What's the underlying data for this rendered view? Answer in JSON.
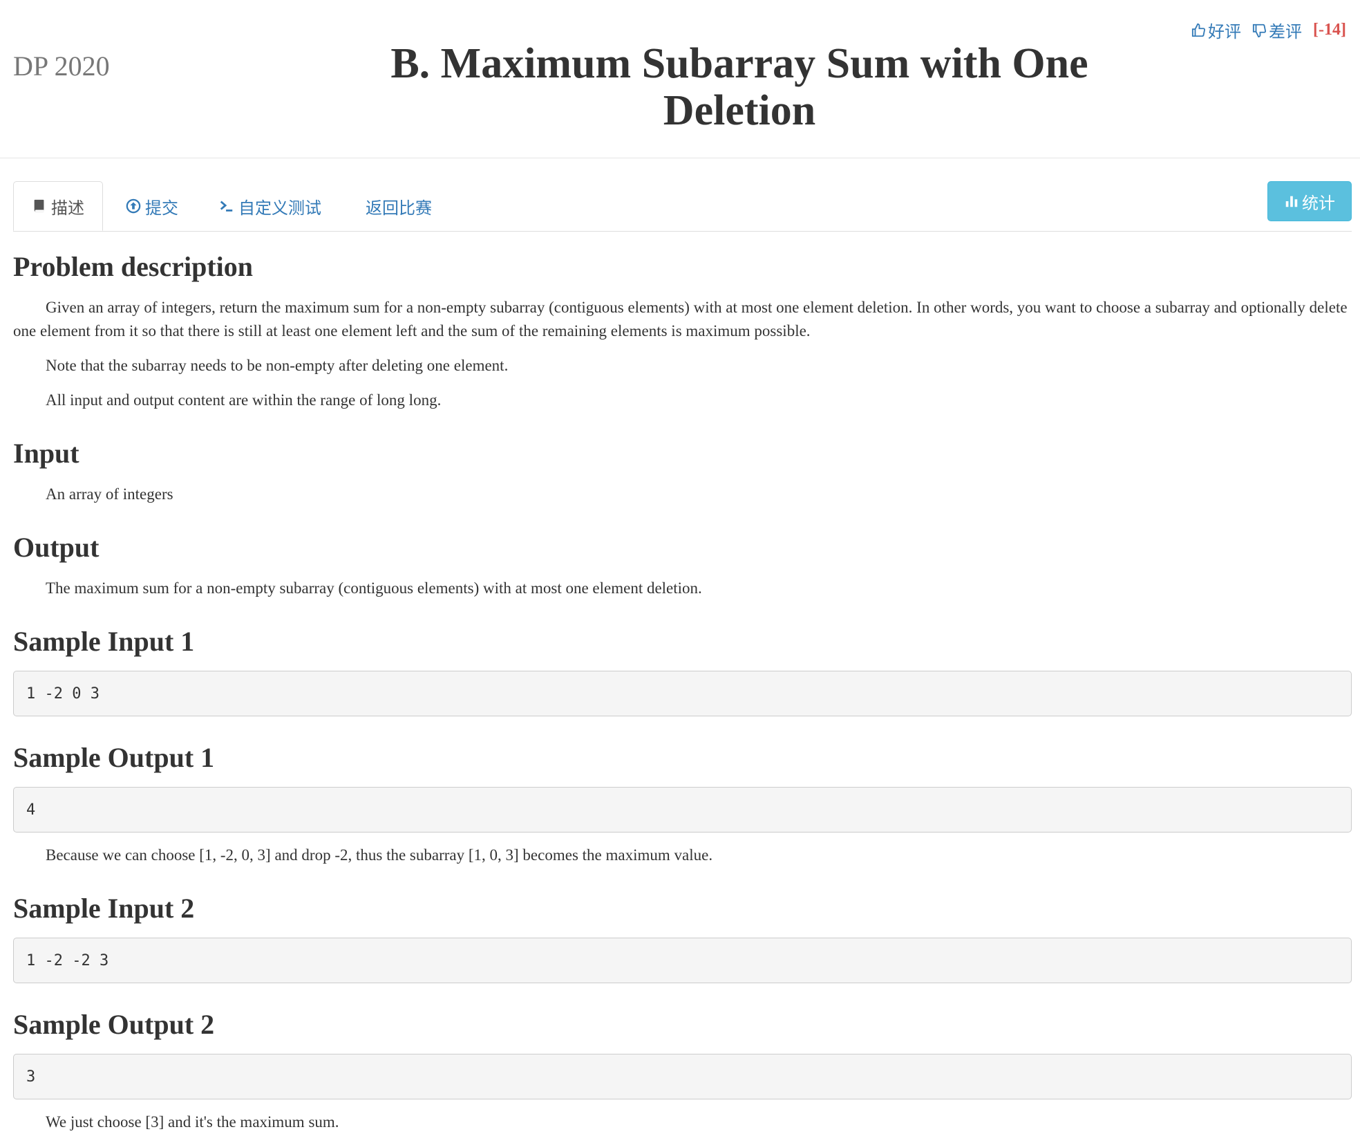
{
  "header": {
    "contest": "DP 2020",
    "title": "B. Maximum Subarray Sum with One Deletion",
    "rating": {
      "like_label": "好评",
      "dislike_label": "差评",
      "score": "[-14]"
    }
  },
  "tabs": [
    {
      "label": "描述",
      "icon": "book-icon",
      "active": true
    },
    {
      "label": "提交",
      "icon": "upload-circle-icon",
      "active": false
    },
    {
      "label": "自定义测试",
      "icon": "terminal-icon",
      "active": false
    },
    {
      "label": "返回比赛",
      "icon": "",
      "active": false
    }
  ],
  "stats_label": "统计",
  "sections": {
    "description": {
      "heading": "Problem description",
      "p1": "Given an array of integers, return the maximum sum for a non-empty subarray (contiguous elements) with at most one element deletion. In other words, you want to choose a subarray and optionally delete one element from it so that there is still at least one element left and the sum of the remaining elements is maximum possible.",
      "p2": "Note that the subarray needs to be non-empty after deleting one element.",
      "p3": "All input and output content are within the range of long long."
    },
    "input": {
      "heading": "Input",
      "text": "An array of integers"
    },
    "output": {
      "heading": "Output",
      "text": "The maximum sum for a non-empty subarray (contiguous elements) with at most one element deletion."
    },
    "sample_input_1": {
      "heading": "Sample Input 1",
      "code": "1 -2 0 3"
    },
    "sample_output_1": {
      "heading": "Sample Output 1",
      "code": "4",
      "note": "Because we can choose [1, -2, 0, 3] and drop -2, thus the subarray [1, 0, 3] becomes the maximum value."
    },
    "sample_input_2": {
      "heading": "Sample Input 2",
      "code": "1 -2 -2 3"
    },
    "sample_output_2": {
      "heading": "Sample Output 2",
      "code": "3",
      "note": "We just choose [3] and it's the maximum sum."
    }
  },
  "colors": {
    "link": "#337ab7",
    "score": "#d9534f",
    "stats_button": "#5bc0de",
    "code_bg": "#f5f5f5"
  }
}
